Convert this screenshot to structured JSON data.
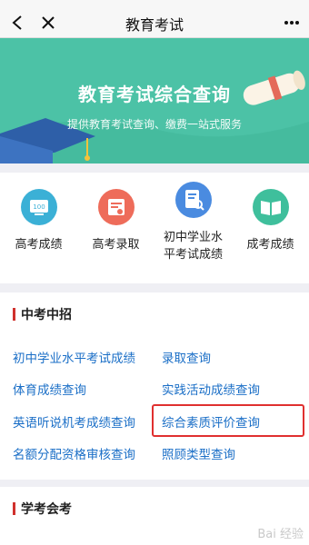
{
  "nav": {
    "title": "教育考试"
  },
  "banner": {
    "title": "教育考试综合查询",
    "subtitle": "提供教育考试查询、缴费一站式服务"
  },
  "services": [
    {
      "label": "高考成绩",
      "icon": "exam-score-icon"
    },
    {
      "label": "高考录取",
      "icon": "admission-icon"
    },
    {
      "label": "初中学业水平考试成绩",
      "icon": "search-doc-icon"
    },
    {
      "label": "成考成绩",
      "icon": "book-icon"
    }
  ],
  "sections": [
    {
      "title": "中考中招",
      "links": [
        "初中学业水平考试成绩",
        "录取查询",
        "体育成绩查询",
        "实践活动成绩查询",
        "英语听说机考成绩查询",
        "综合素质评价查询",
        "名额分配资格审核查询",
        "照顾类型查询"
      ]
    },
    {
      "title": "学考会考"
    }
  ],
  "watermark": "Bai 经验",
  "colors": {
    "accent": "#49c0a3",
    "link": "#1b6fc7",
    "section_bar": "#d0312d",
    "highlight": "#e0302f"
  }
}
